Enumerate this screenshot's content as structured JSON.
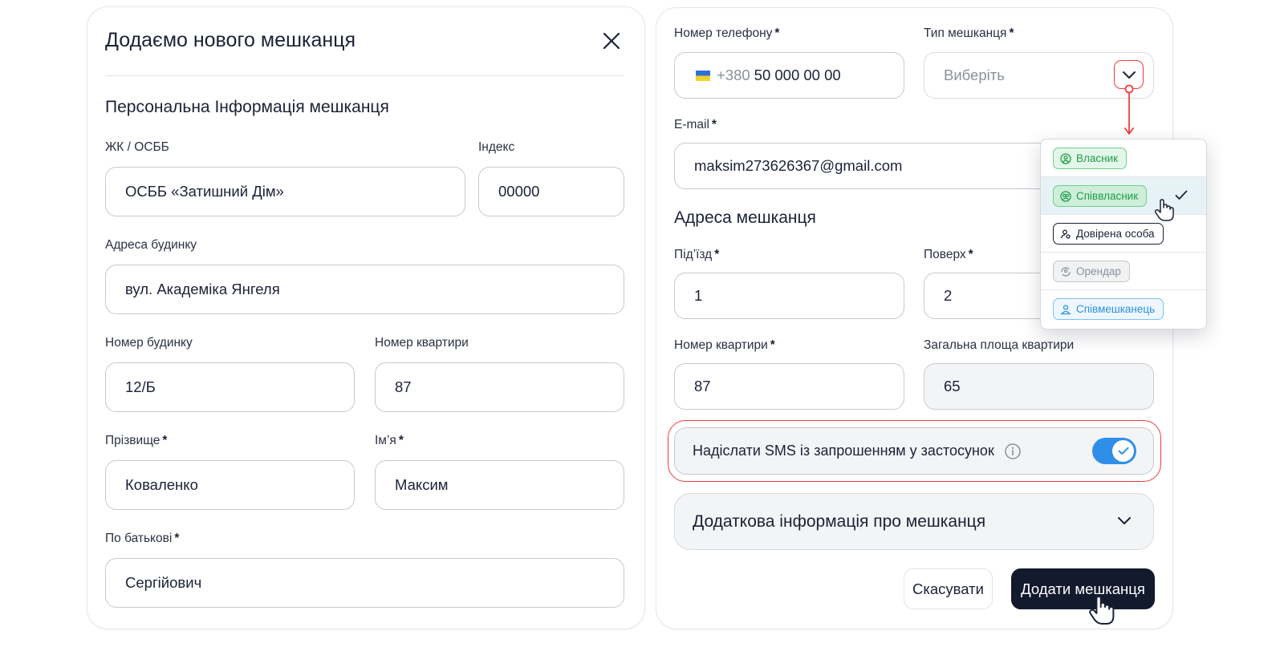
{
  "left_card": {
    "title": "Додаємо нового мешканця",
    "section_title": "Персональна Інформація мешканця",
    "required_mark": "*",
    "fields": {
      "osbb": {
        "label": "ЖК / ОСББ",
        "value": "ОСББ «Затишний Дім»"
      },
      "index": {
        "label": "Індекс",
        "value": "00000"
      },
      "address": {
        "label": "Адреса будинку",
        "value": "вул. Академіка Янгеля"
      },
      "house": {
        "label": "Номер будинку",
        "value": "12/Б"
      },
      "apartment": {
        "label": "Номер квартири",
        "value": "87"
      },
      "surname": {
        "label": "Прізвище",
        "value": "Коваленко"
      },
      "name": {
        "label": "Ім’я",
        "value": "Максим"
      },
      "patronymic": {
        "label": "По батькові",
        "value": "Сергійович"
      }
    }
  },
  "right_card": {
    "phone": {
      "label": "Номер телефону",
      "prefix": "+380",
      "value": "50 000 00 00"
    },
    "type": {
      "label": "Тип мешканця",
      "placeholder": "Виберіть"
    },
    "email": {
      "label": "E-mail",
      "value": "maksim273626367@gmail.com"
    },
    "address_section_title": "Адреса мешканця",
    "entrance": {
      "label": "Під’їзд",
      "value": "1"
    },
    "floor": {
      "label": "Поверх",
      "value": "2"
    },
    "apartment": {
      "label": "Номер квартири",
      "value": "87"
    },
    "area": {
      "label": "Загальна площа квартири",
      "value": "65"
    },
    "sms": {
      "label": "Надіслати SMS із запрошенням у застосунок",
      "enabled": true
    },
    "additional": {
      "label": "Додаткова інформація про мешканця"
    },
    "buttons": {
      "cancel": "Скасувати",
      "add": "Додати мешканця"
    }
  },
  "dropdown": {
    "options": [
      {
        "label": "Власник",
        "selected": false,
        "icon": "user-circle-icon"
      },
      {
        "label": "Співвласник",
        "selected": true,
        "icon": "users-circle-icon"
      },
      {
        "label": "Довірена особа",
        "selected": false,
        "icon": "user-key-icon"
      },
      {
        "label": "Орендар",
        "selected": false,
        "icon": "user-refresh-icon"
      },
      {
        "label": "Співмешканець",
        "selected": false,
        "icon": "user-icon"
      }
    ]
  },
  "colors": {
    "accent_red": "#ef3e3e",
    "toggle_blue": "#2f8fe8",
    "primary_dark": "#131a2e",
    "green": "#1f9c4b",
    "blue": "#2c8fdc"
  }
}
